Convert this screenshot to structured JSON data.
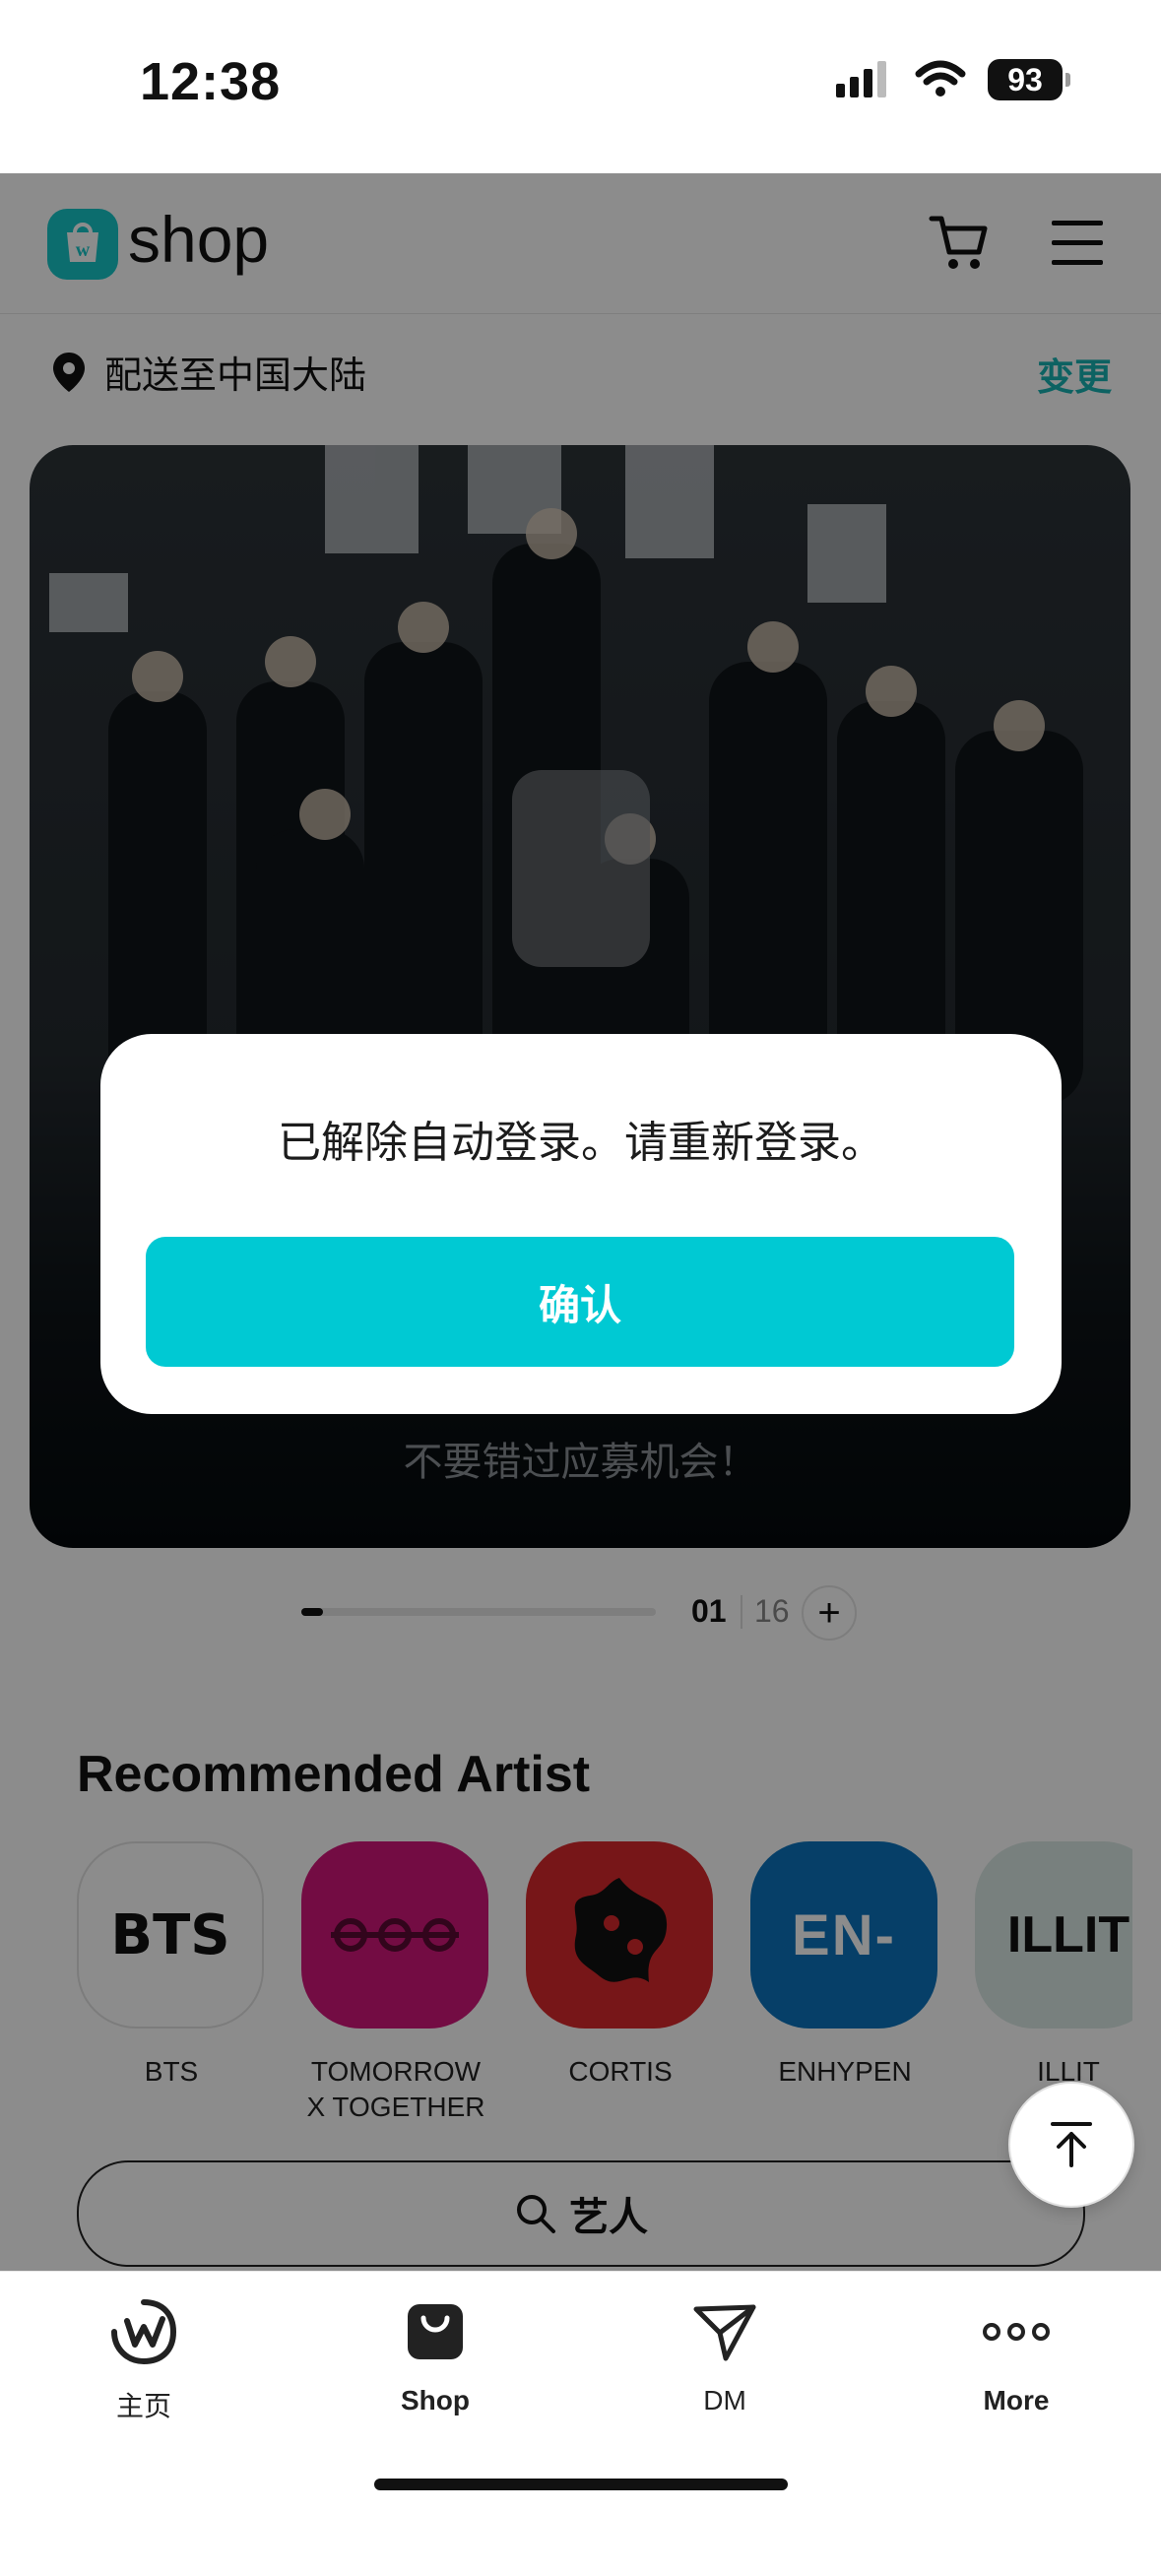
{
  "status_bar": {
    "time": "12:38",
    "battery": "93"
  },
  "header": {
    "logo_letter": "w",
    "logo_text": "shop"
  },
  "delivery": {
    "text": "配送至中国大陆",
    "change_label": "变更"
  },
  "banner": {
    "caption": "不要错过应募机会！"
  },
  "pager": {
    "current": "01",
    "total": "16",
    "plus": "+"
  },
  "recommended": {
    "title": "Recommended Artist",
    "artists": [
      {
        "name": "BTS",
        "logo_text": "BTS",
        "bg": "#ffffff",
        "fg": "#111111"
      },
      {
        "name": "TOMORROW X TOGETHER",
        "logo_text": "",
        "bg": "#d1177a",
        "fg": "#5b0a33"
      },
      {
        "name": "CORTIS",
        "logo_text": "",
        "bg": "#d9292c",
        "fg": "#111111"
      },
      {
        "name": "ENHYPEN",
        "logo_text": "EN-",
        "bg": "#0b74bd",
        "fg": "#ffffff"
      },
      {
        "name": "ILLIT",
        "logo_text": "ILLIT",
        "bg": "#dbe9e5",
        "fg": "#111111"
      }
    ],
    "search_label": "艺人"
  },
  "dialog": {
    "message": "已解除自动登录。请重新登录。",
    "confirm_label": "确认"
  },
  "bottom_nav": {
    "items": [
      {
        "label": "主页",
        "icon": "weverse-home-icon"
      },
      {
        "label": "Shop",
        "icon": "shop-bag-icon"
      },
      {
        "label": "DM",
        "icon": "send-icon"
      },
      {
        "label": "More",
        "icon": "more-dots-icon"
      }
    ]
  },
  "colors": {
    "accent": "#00c9d3",
    "logo": "#16c6c8",
    "link": "#19b3b3"
  }
}
